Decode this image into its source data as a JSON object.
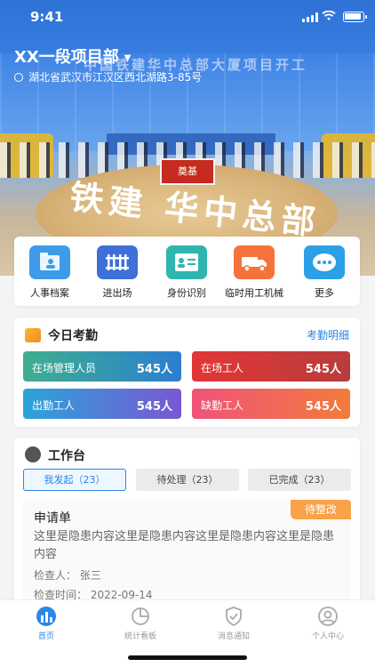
{
  "status_bar": {
    "time": "9:41"
  },
  "header": {
    "project_name": "XX一段项目部",
    "address": "湖北省武汉市江汉区西北湖路3-85号",
    "banner_text": "中国铁建华中总部大厦项目开工",
    "mound_text": "铁建 华中总部",
    "plaque_text": "奠基"
  },
  "quick_menu": [
    {
      "label": "人事档案",
      "icon": "folder-person-icon",
      "color": "#3d9be9"
    },
    {
      "label": "进出场",
      "icon": "gate-icon",
      "color": "#3f6fd8"
    },
    {
      "label": "身份识别",
      "icon": "id-card-icon",
      "color": "#2fb5b0"
    },
    {
      "label": "临时用工机械",
      "icon": "truck-icon",
      "color": "#f5733a"
    },
    {
      "label": "更多",
      "icon": "more-icon",
      "color": "#2d9fe6"
    }
  ],
  "attendance": {
    "title": "今日考勤",
    "detail_link": "考勤明细",
    "stats": [
      {
        "label": "在场管理人员",
        "value": "545人",
        "colors": [
          "#3fae8e",
          "#2b7fd0"
        ]
      },
      {
        "label": "在场工人",
        "value": "545人",
        "colors": [
          "#e23636",
          "#b93c3c"
        ]
      },
      {
        "label": "出勤工人",
        "value": "545人",
        "colors": [
          "#2aa4d9",
          "#7a57d4"
        ]
      },
      {
        "label": "缺勤工人",
        "value": "545人",
        "colors": [
          "#f0537a",
          "#f37b3b"
        ]
      }
    ]
  },
  "workbench": {
    "title": "工作台",
    "tabs": [
      "我发起（23）",
      "待处理（23）",
      "已完成（23）"
    ],
    "active_tab": 0,
    "request": {
      "title": "申请单",
      "badge": "待整改",
      "content": "这里是隐患内容这里是隐患内容这里是隐患内容这里是隐患内容",
      "inspector": "检查人：   张三",
      "inspect_time": "检查时间：  2022-09-14"
    }
  },
  "tabbar": [
    {
      "label": "首页",
      "icon": "home-chart-icon",
      "active": true
    },
    {
      "label": "统计看板",
      "icon": "pie-chart-icon",
      "active": false
    },
    {
      "label": "消息通知",
      "icon": "shield-check-icon",
      "active": false
    },
    {
      "label": "个人中心",
      "icon": "user-icon",
      "active": false
    }
  ],
  "colors": {
    "accent": "#2d86e8",
    "badge": "#f9a24a"
  }
}
